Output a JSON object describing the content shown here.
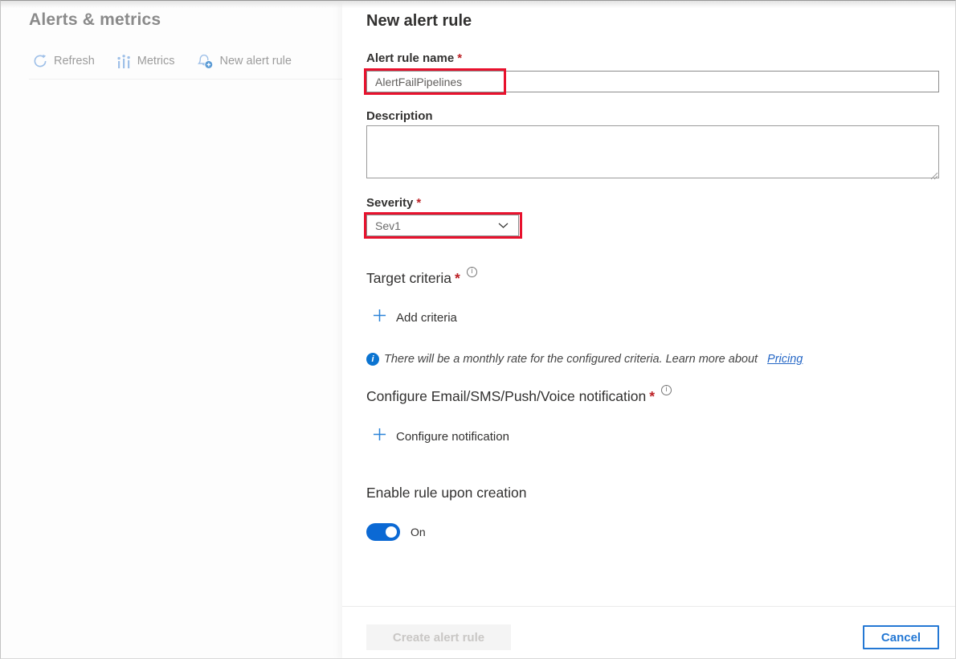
{
  "colors": {
    "accent_blue": "#0b74d1",
    "link_blue": "#2567c6",
    "required_red": "#bc2025",
    "callout_red": "#e8112d",
    "toggle_on_blue": "#0b69d4",
    "dim_icon_blue": "#9fc0e8",
    "cancel_border_blue": "#2478d4"
  },
  "left_panel": {
    "title": "Alerts & metrics",
    "toolbar": [
      {
        "label": "Refresh"
      },
      {
        "label": "Metrics"
      },
      {
        "label": "New alert rule"
      }
    ]
  },
  "panel": {
    "title": "New alert rule",
    "alert_rule_name": {
      "label": "Alert rule name",
      "required": "*",
      "value": "AlertFailPipelines"
    },
    "description": {
      "label": "Description",
      "value": ""
    },
    "severity": {
      "label": "Severity",
      "required": "*",
      "value": "Sev1"
    },
    "target_criteria": {
      "heading": "Target criteria",
      "required": "*",
      "add_label": "Add criteria"
    },
    "pricing_note": {
      "text": "There will be a monthly rate for the configured criteria. Learn more about",
      "link_label": "Pricing"
    },
    "notification": {
      "heading": "Configure Email/SMS/Push/Voice notification",
      "required": "*",
      "add_label": "Configure notification"
    },
    "enable_rule": {
      "label": "Enable rule upon creation",
      "toggle_state": "On"
    },
    "footer": {
      "create_label": "Create alert rule",
      "cancel_label": "Cancel"
    }
  }
}
